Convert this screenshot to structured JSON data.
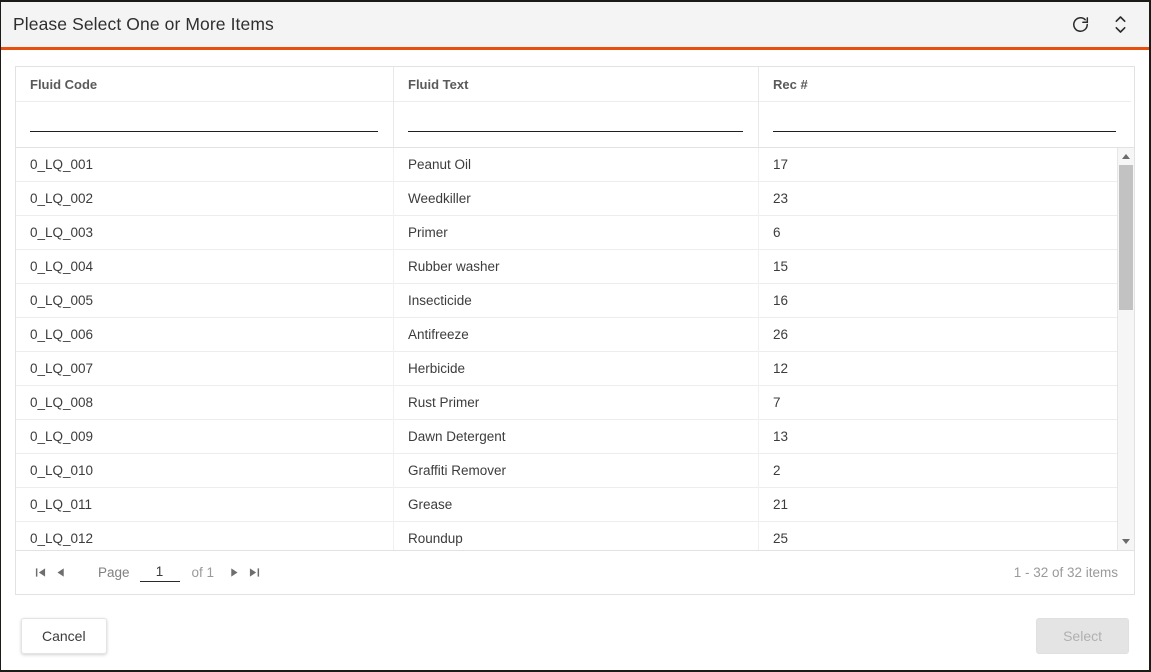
{
  "titlebar": {
    "title": "Please Select One or More Items",
    "refresh_icon": "refresh-icon",
    "expand_icon": "expand-collapse-icon"
  },
  "grid": {
    "columns": [
      {
        "header": "Fluid Code",
        "filter_value": "",
        "filter_placeholder": ""
      },
      {
        "header": "Fluid Text",
        "filter_value": "",
        "filter_placeholder": ""
      },
      {
        "header": "Rec #",
        "filter_value": "",
        "filter_placeholder": ""
      }
    ],
    "rows": [
      {
        "fluid_code": "0_LQ_001",
        "fluid_text": "Peanut Oil",
        "rec": "17"
      },
      {
        "fluid_code": "0_LQ_002",
        "fluid_text": "Weedkiller",
        "rec": "23"
      },
      {
        "fluid_code": "0_LQ_003",
        "fluid_text": "Primer",
        "rec": "6"
      },
      {
        "fluid_code": "0_LQ_004",
        "fluid_text": "Rubber washer",
        "rec": "15"
      },
      {
        "fluid_code": "0_LQ_005",
        "fluid_text": "Insecticide",
        "rec": "16"
      },
      {
        "fluid_code": "0_LQ_006",
        "fluid_text": "Antifreeze",
        "rec": "26"
      },
      {
        "fluid_code": "0_LQ_007",
        "fluid_text": "Herbicide",
        "rec": "12"
      },
      {
        "fluid_code": "0_LQ_008",
        "fluid_text": "Rust Primer",
        "rec": "7"
      },
      {
        "fluid_code": "0_LQ_009",
        "fluid_text": "Dawn Detergent",
        "rec": "13"
      },
      {
        "fluid_code": "0_LQ_010",
        "fluid_text": "Graffiti Remover",
        "rec": "2"
      },
      {
        "fluid_code": "0_LQ_011",
        "fluid_text": "Grease",
        "rec": "21"
      },
      {
        "fluid_code": "0_LQ_012",
        "fluid_text": "Roundup",
        "rec": "25"
      }
    ]
  },
  "pager": {
    "first_label": "⧏|",
    "page_label": "Page",
    "page_value": "1",
    "of_label": "of 1",
    "info": "1 - 32 of 32 items"
  },
  "footer": {
    "cancel_label": "Cancel",
    "select_label": "Select"
  },
  "colors": {
    "accent": "#e8500f",
    "titlebar_bg": "#f4f4f4",
    "grid_border": "#e2e2e2",
    "scroll_thumb": "#c2c2c2",
    "disabled_bg": "#e4e4e4",
    "disabled_text": "#b0b0b0"
  }
}
